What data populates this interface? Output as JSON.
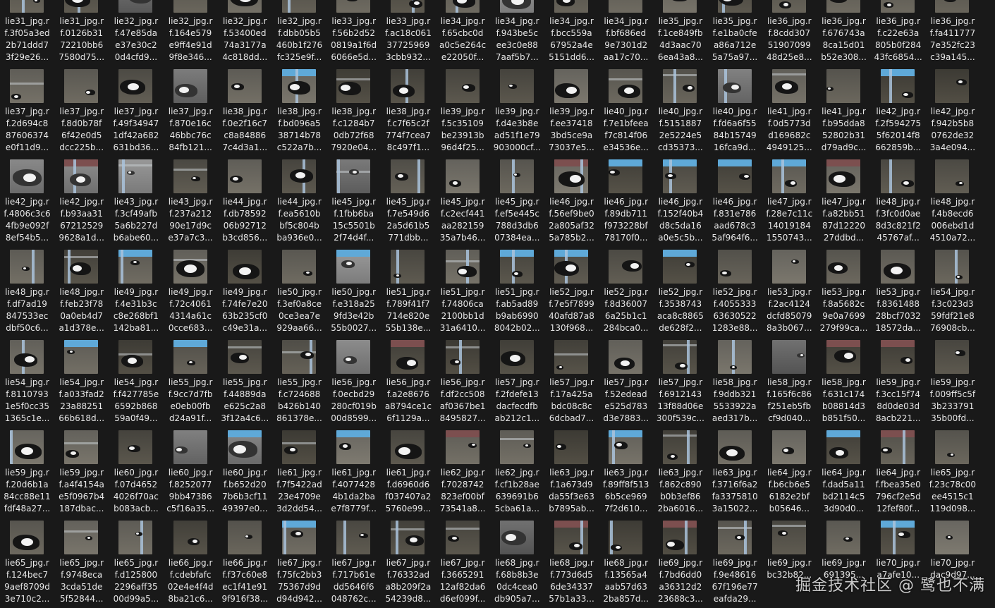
{
  "rows": [
    [
      [
        "lie31_jpg.r",
        "f.3f05a3ed",
        "2b71ddd7",
        "3f29e26..."
      ],
      [
        "lie31_jpg.r",
        "f.0126b31",
        "72210bb6",
        "7580d75..."
      ],
      [
        "lie32_jpg.r",
        "f.47e85da",
        "e37e30c2",
        "0d4cfd9..."
      ],
      [
        "lie32_jpg.r",
        "f.164e579",
        "e9ff4e91d",
        "9f8e346..."
      ],
      [
        "lie32_jpg.r",
        "f.53400ed",
        "74a3177a",
        "4c818dd..."
      ],
      [
        "lie32_jpg.r",
        "f.dbb05b5",
        "460b1f276",
        "fc325e9f..."
      ],
      [
        "lie33_jpg.r",
        "f.56b2d52",
        "0819a1f6d",
        "6066e5d..."
      ],
      [
        "lie33_jpg.r",
        "f.ac18c061",
        "37725969",
        "3cbb932..."
      ],
      [
        "lie34_jpg.r",
        "f.65cbc0d",
        "a0c5e264c",
        "e22050f..."
      ],
      [
        "lie34_jpg.r",
        "f.943be5c",
        "ee3c0e88",
        "7aaf5b7..."
      ],
      [
        "lie34_jpg.r",
        "f.bcc559a",
        "67952a4e",
        "5151dd6..."
      ],
      [
        "lie34_jpg.r",
        "f.bf686ed",
        "9e7301d2",
        "aa17c70..."
      ],
      [
        "lie35_jpg.r",
        "f.1ce849fb",
        "4d3aac70",
        "6ea43a8..."
      ],
      [
        "lie35_jpg.r",
        "f.e1ba0cfe",
        "a86a712e",
        "5a75a97..."
      ],
      [
        "lie36_jpg.r",
        "f.8cdd307",
        "51907099",
        "48d25e8..."
      ],
      [
        "lie36_jpg.r",
        "f.676743a",
        "8ca15d01",
        "b52e308..."
      ],
      [
        "lie36_jpg.r",
        "f.c22e63a",
        "805b0f284",
        "43fc6854..."
      ],
      [
        "lie36_jpg.r",
        "f.fa411777",
        "7e352fc23",
        "c39a145..."
      ]
    ],
    [
      [
        "lie37_jpg.r",
        "f.2d694c8",
        "87606374",
        "e0f11d9..."
      ],
      [
        "lie37_jpg.r",
        "f.8d0b78f",
        "6f42e0d5",
        "dcc225b..."
      ],
      [
        "lie37_jpg.r",
        "f.49f34947",
        "1df42a682",
        "631bd36..."
      ],
      [
        "lie37_jpg.r",
        "f.870e16c",
        "46bbc76c",
        "84fb121..."
      ],
      [
        "lie38_jpg.r",
        "f.0e2f16c7",
        "c8a84886",
        "7c4d3a1..."
      ],
      [
        "lie38_jpg.r",
        "f.bd096a5",
        "38714b78",
        "c522a7b..."
      ],
      [
        "lie38_jpg.r",
        "f.c1284b7",
        "0db72f68",
        "7920e04..."
      ],
      [
        "lie38_jpg.r",
        "f.c7f65c2f",
        "774f7cea7",
        "8c497f1..."
      ],
      [
        "lie39_jpg.r",
        "f.5c35109",
        "be23913b",
        "96d4f25..."
      ],
      [
        "lie39_jpg.r",
        "f.d4e3b8e",
        "ad51f1e79",
        "903000cf..."
      ],
      [
        "lie39_jpg.r",
        "f.ee37418",
        "3bd5ce9a",
        "73037e5..."
      ],
      [
        "lie40_jpg.r",
        "f.7e1bfeea",
        "f7c814f06",
        "e34536e..."
      ],
      [
        "lie40_jpg.r",
        "f.5151887",
        "2e5224e5",
        "cd35373..."
      ],
      [
        "lie40_jpg.r",
        "f.fd6a6f55",
        "84b15749",
        "16fca9d..."
      ],
      [
        "lie41_jpg.r",
        "f.0d5773d",
        "d169682c",
        "4949125..."
      ],
      [
        "lie41_jpg.r",
        "f.b95dda8",
        "52802b31",
        "d79ad9c..."
      ],
      [
        "lie42_jpg.r",
        "f.2f594275",
        "5f62014f8",
        "662859b..."
      ],
      [
        "lie42_jpg.r",
        "f.942b5b8",
        "0762de32",
        "3a4e094..."
      ]
    ],
    [
      [
        "lie42_jpg.r",
        "f.4806c3c6",
        "4fb9e092f",
        "8ef54b5..."
      ],
      [
        "lie42_jpg.r",
        "f.b93aa31",
        "67212529",
        "9628a1d..."
      ],
      [
        "lie43_jpg.r",
        "f.3cf49afb",
        "5a6b227d",
        "b6abe60..."
      ],
      [
        "lie43_jpg.r",
        "f.237a212",
        "90e17d9c",
        "e37a7c3..."
      ],
      [
        "lie44_jpg.r",
        "f.db78592",
        "06b92712",
        "b3cd856..."
      ],
      [
        "lie44_jpg.r",
        "f.ea5610b",
        "bf5c804b",
        "ba936e0..."
      ],
      [
        "lie45_jpg.r",
        "f.1fbb6ba",
        "15c5501b",
        "2f74d4f..."
      ],
      [
        "lie45_jpg.r",
        "f.7e549d6",
        "2a5d61b5",
        "771dbb..."
      ],
      [
        "lie45_jpg.r",
        "f.c2ecf441",
        "aa282159",
        "35a7b46..."
      ],
      [
        "lie45_jpg.r",
        "f.ef5e445c",
        "788d3db6",
        "07384ea..."
      ],
      [
        "lie46_jpg.r",
        "f.56ef9be0",
        "2a805af32",
        "5a785b2..."
      ],
      [
        "lie46_jpg.r",
        "f.89db711",
        "f973228bf",
        "78170f0..."
      ],
      [
        "lie46_jpg.r",
        "f.152f40b4",
        "d8c5da16",
        "a0e5c5b..."
      ],
      [
        "lie46_jpg.r",
        "f.831e786",
        "aad678c3",
        "5af964f6..."
      ],
      [
        "lie47_jpg.r",
        "f.28e7c11c",
        "14019184",
        "1550743..."
      ],
      [
        "lie47_jpg.r",
        "f.a82bb51",
        "87d12220",
        "27ddbd..."
      ],
      [
        "lie48_jpg.r",
        "f.3fc0d0ae",
        "8d3c821f2",
        "45767af..."
      ],
      [
        "lie48_jpg.r",
        "f.4b8ecd6",
        "006ebd1d",
        "4510a72..."
      ]
    ],
    [
      [
        "lie48_jpg.r",
        "f.df7ad19",
        "847533ec",
        "dbf50c6..."
      ],
      [
        "lie48_jpg.r",
        "f.feb23f78",
        "0a0eb4d7",
        "a1d378e..."
      ],
      [
        "lie49_jpg.r",
        "f.4e31b3c",
        "c8e268bf1",
        "142ba81..."
      ],
      [
        "lie49_jpg.r",
        "f.72c4061",
        "4314a61c",
        "0cce683..."
      ],
      [
        "lie49_jpg.r",
        "f.74fe7e20",
        "63b235cf0",
        "c49e31a..."
      ],
      [
        "lie50_jpg.r",
        "f.3ef0a8ce",
        "0ce3ea7e",
        "929aa66..."
      ],
      [
        "lie50_jpg.r",
        "f.e318a25",
        "9fd3e42b",
        "55b0027..."
      ],
      [
        "lie51_jpg.r",
        "f.789f41f7",
        "714e820e",
        "55b138e..."
      ],
      [
        "lie51_jpg.r",
        "f.74806ca",
        "2100bb1d",
        "31a6410..."
      ],
      [
        "lie51_jpg.r",
        "f.ab5ad89",
        "b9ab6990",
        "8042b02..."
      ],
      [
        "lie52_jpg.r",
        "f.7e5f7899",
        "40afd87a8",
        "130f968..."
      ],
      [
        "lie52_jpg.r",
        "f.8d36007",
        "6a25b1c1",
        "284bca0..."
      ],
      [
        "lie52_jpg.r",
        "f.3538743",
        "aca8c8865",
        "de628f2..."
      ],
      [
        "lie52_jpg.r",
        "f.4055333",
        "63630522",
        "1283e88..."
      ],
      [
        "lie53_jpg.r",
        "f.2ac4124",
        "dcfd85079",
        "8a3b067..."
      ],
      [
        "lie53_jpg.r",
        "f.8a5682c",
        "9e0a7699",
        "279f99ca..."
      ],
      [
        "lie53_jpg.r",
        "f.8361488",
        "28bcf7032",
        "18572da..."
      ],
      [
        "lie54_jpg.r",
        "f.3c023d3",
        "59fdf21e8",
        "76908cb..."
      ]
    ],
    [
      [
        "lie54_jpg.r",
        "f.8110793",
        "1e5f0cc35",
        "1365c1e..."
      ],
      [
        "lie54_jpg.r",
        "f.a033fad2",
        "23a88251",
        "66b618d..."
      ],
      [
        "lie54_jpg.r",
        "f.f427785e",
        "6592b868",
        "59a0f49..."
      ],
      [
        "lie55_jpg.r",
        "f.9cc7d7fb",
        "e0eb00fb",
        "d24a91f..."
      ],
      [
        "lie55_jpg.r",
        "f.44889da",
        "e625c2a8",
        "3f12a4c6..."
      ],
      [
        "lie55_jpg.r",
        "f.c724688",
        "b426b140",
        "861378e..."
      ],
      [
        "lie56_jpg.r",
        "f.0ecbd29",
        "280cf019b",
        "00d8599..."
      ],
      [
        "lie56_jpg.r",
        "f.a2e8676",
        "a8794ce1c",
        "6f1129a..."
      ],
      [
        "lie56_jpg.r",
        "f.df2cc508",
        "af0367be1",
        "8495827..."
      ],
      [
        "lie57_jpg.r",
        "f.2fdefe13",
        "dacfecdfb",
        "ab212c1..."
      ],
      [
        "lie57_jpg.r",
        "f.17a425a",
        "bdc08c8c",
        "6dcbad7..."
      ],
      [
        "lie57_jpg.r",
        "f.52edead",
        "e525d783",
        "d3e7883..."
      ],
      [
        "lie57_jpg.r",
        "f.6912143",
        "13f88d06e",
        "300f539c..."
      ],
      [
        "lie58_jpg.r",
        "f.9ddb321",
        "5533922a",
        "aed317b..."
      ],
      [
        "lie58_jpg.r",
        "f.165f6c86",
        "f251eb5fb",
        "cf9d040..."
      ],
      [
        "lie58_jpg.r",
        "f.631c174",
        "b08814d3",
        "b851f50..."
      ],
      [
        "lie59_jpg.r",
        "f.3cc15f74",
        "8d0de03d",
        "8acb221..."
      ],
      [
        "lie59_jpg.r",
        "f.009ff5c5f",
        "3b233791",
        "35b00fd..."
      ]
    ],
    [
      [
        "lie59_jpg.r",
        "f.20d6b1a",
        "84cc88e11",
        "fdf48a27..."
      ],
      [
        "lie59_jpg.r",
        "f.a4f4154a",
        "e5f0967b4",
        "187dbac..."
      ],
      [
        "lie60_jpg.r",
        "f.07d4652",
        "4026f70ac",
        "b083acb..."
      ],
      [
        "lie60_jpg.r",
        "f.8252077",
        "9bb47386",
        "c5f16a35..."
      ],
      [
        "lie60_jpg.r",
        "f.b652d20",
        "7b6b3cf11",
        "49397e0..."
      ],
      [
        "lie61_jpg.r",
        "f.7f5422ad",
        "23e4709e",
        "3d2dd54..."
      ],
      [
        "lie61_jpg.r",
        "f.4077428",
        "4b1da2ba",
        "e7f8779f..."
      ],
      [
        "lie61_jpg.r",
        "f.d6960d6",
        "f037407a2",
        "5760e99..."
      ],
      [
        "lie62_jpg.r",
        "f.7028742",
        "823ef00bf",
        "73541a8..."
      ],
      [
        "lie62_jpg.r",
        "f.cf1b28ae",
        "639691b6",
        "5cba61a..."
      ],
      [
        "lie63_jpg.r",
        "f.1a673d9",
        "da55f3e63",
        "b7895ab..."
      ],
      [
        "lie63_jpg.r",
        "f.89ff8f513",
        "6b5ce969",
        "7f2d610..."
      ],
      [
        "lie63_jpg.r",
        "f.862c890",
        "b0b3ef86",
        "2ba6016..."
      ],
      [
        "lie63_jpg.r",
        "f.3716f6a2",
        "fa3375810",
        "3a15022..."
      ],
      [
        "lie64_jpg.r",
        "f.b6cb6e5",
        "6182e2bf",
        "b05646..."
      ],
      [
        "lie64_jpg.r",
        "f.dad5a11",
        "bd2114c5",
        "3d90d0..."
      ],
      [
        "lie64_jpg.r",
        "f.fbea35e0",
        "796cf2e5d",
        "12fef80f..."
      ],
      [
        "lie65_jpg.r",
        "f.23c78c00",
        "ee4515c1",
        "119d098..."
      ]
    ],
    [
      [
        "lie65_jpg.r",
        "f.124bec7",
        "9aef8709d",
        "3e710c2..."
      ],
      [
        "lie65_jpg.r",
        "f.9748eca",
        "3cda51de",
        "5f52844..."
      ],
      [
        "lie65_jpg.r",
        "f.d125800",
        "2296aff35",
        "00d99a5..."
      ],
      [
        "lie66_jpg.r",
        "f.cdebfafc",
        "02e4e4f4d",
        "8ba21c6..."
      ],
      [
        "lie66_jpg.r",
        "f.f37c60e8",
        "ec1f41e91",
        "9f916f38..."
      ],
      [
        "lie67_jpg.r",
        "f.75fc2bb3",
        "75367d9d",
        "d94d942..."
      ],
      [
        "lie67_jpg.r",
        "f.717b61e",
        "dd5646f6",
        "048762c..."
      ],
      [
        "lie67_jpg.r",
        "f.76332ad",
        "a8b209f2a",
        "54239d8..."
      ],
      [
        "lie67_jpg.r",
        "f.3665291",
        "12af82da6",
        "d6ef099f..."
      ],
      [
        "lie68_jpg.r",
        "f.68b8b3e",
        "0dc4cea0",
        "db905a7..."
      ],
      [
        "lie68_jpg.r",
        "f.773d6d5",
        "6de34337",
        "57b1a33..."
      ],
      [
        "lie68_jpg.r",
        "f.13565a4",
        "aab57d63",
        "2ba857d..."
      ],
      [
        "lie69_jpg.r",
        "f.7bd6dd0",
        "a36312d2",
        "23688c3..."
      ],
      [
        "lie69_jpg.r",
        "f.9e48616",
        "67f196e77",
        "eafda29..."
      ],
      [
        "lie69_jpg.r",
        "",
        "bc32b82...",
        ""
      ],
      [
        "lie69_jpg.r",
        "",
        "691395...",
        ""
      ],
      [
        "lie70_jpg.r",
        "",
        "a7afe10...",
        ""
      ],
      [
        "lie70_jpg.r",
        "",
        "dac9d97...",
        ""
      ]
    ]
  ],
  "watermark": "掘金技术社区 @ 鹭也不满",
  "colors": {
    "background": "#191919",
    "label_text": "#e6e6e6",
    "dirt": "#6b6a63",
    "cow_black": "#151515",
    "cow_white": "#eeeeee",
    "fence_blue": "#a9c4dc"
  }
}
